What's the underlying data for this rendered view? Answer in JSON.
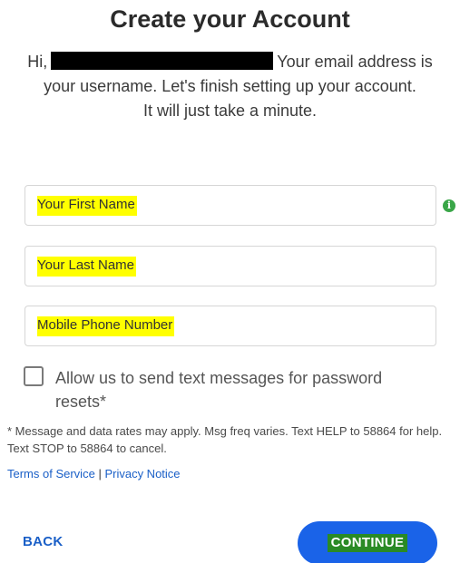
{
  "header": {
    "title": "Create your Account"
  },
  "intro": {
    "greeting": "Hi,",
    "line1_end": "Your email address is",
    "line2": "your username. Let's finish setting up your account.",
    "line3": "It will just take a minute."
  },
  "form": {
    "first_name_placeholder": "Your First Name",
    "last_name_placeholder": "Your Last Name",
    "phone_placeholder": "Mobile Phone Number",
    "info_icon": "info-icon",
    "sms_checkbox_label": "Allow us to send text messages for password resets*",
    "sms_checked": false
  },
  "disclaimer": {
    "text": "* Message and data rates may apply. Msg freq varies. Text HELP to 58864 for help. Text STOP to 58864 to cancel.",
    "terms_link": "Terms of Service",
    "separator": "|",
    "privacy_link": "Privacy Notice"
  },
  "actions": {
    "back_label": "BACK",
    "continue_label": "CONTINUE"
  },
  "colors": {
    "primary": "#1a63e8",
    "link": "#1a5fc7",
    "info_green": "#3aa648",
    "highlight": "#ffff00"
  }
}
